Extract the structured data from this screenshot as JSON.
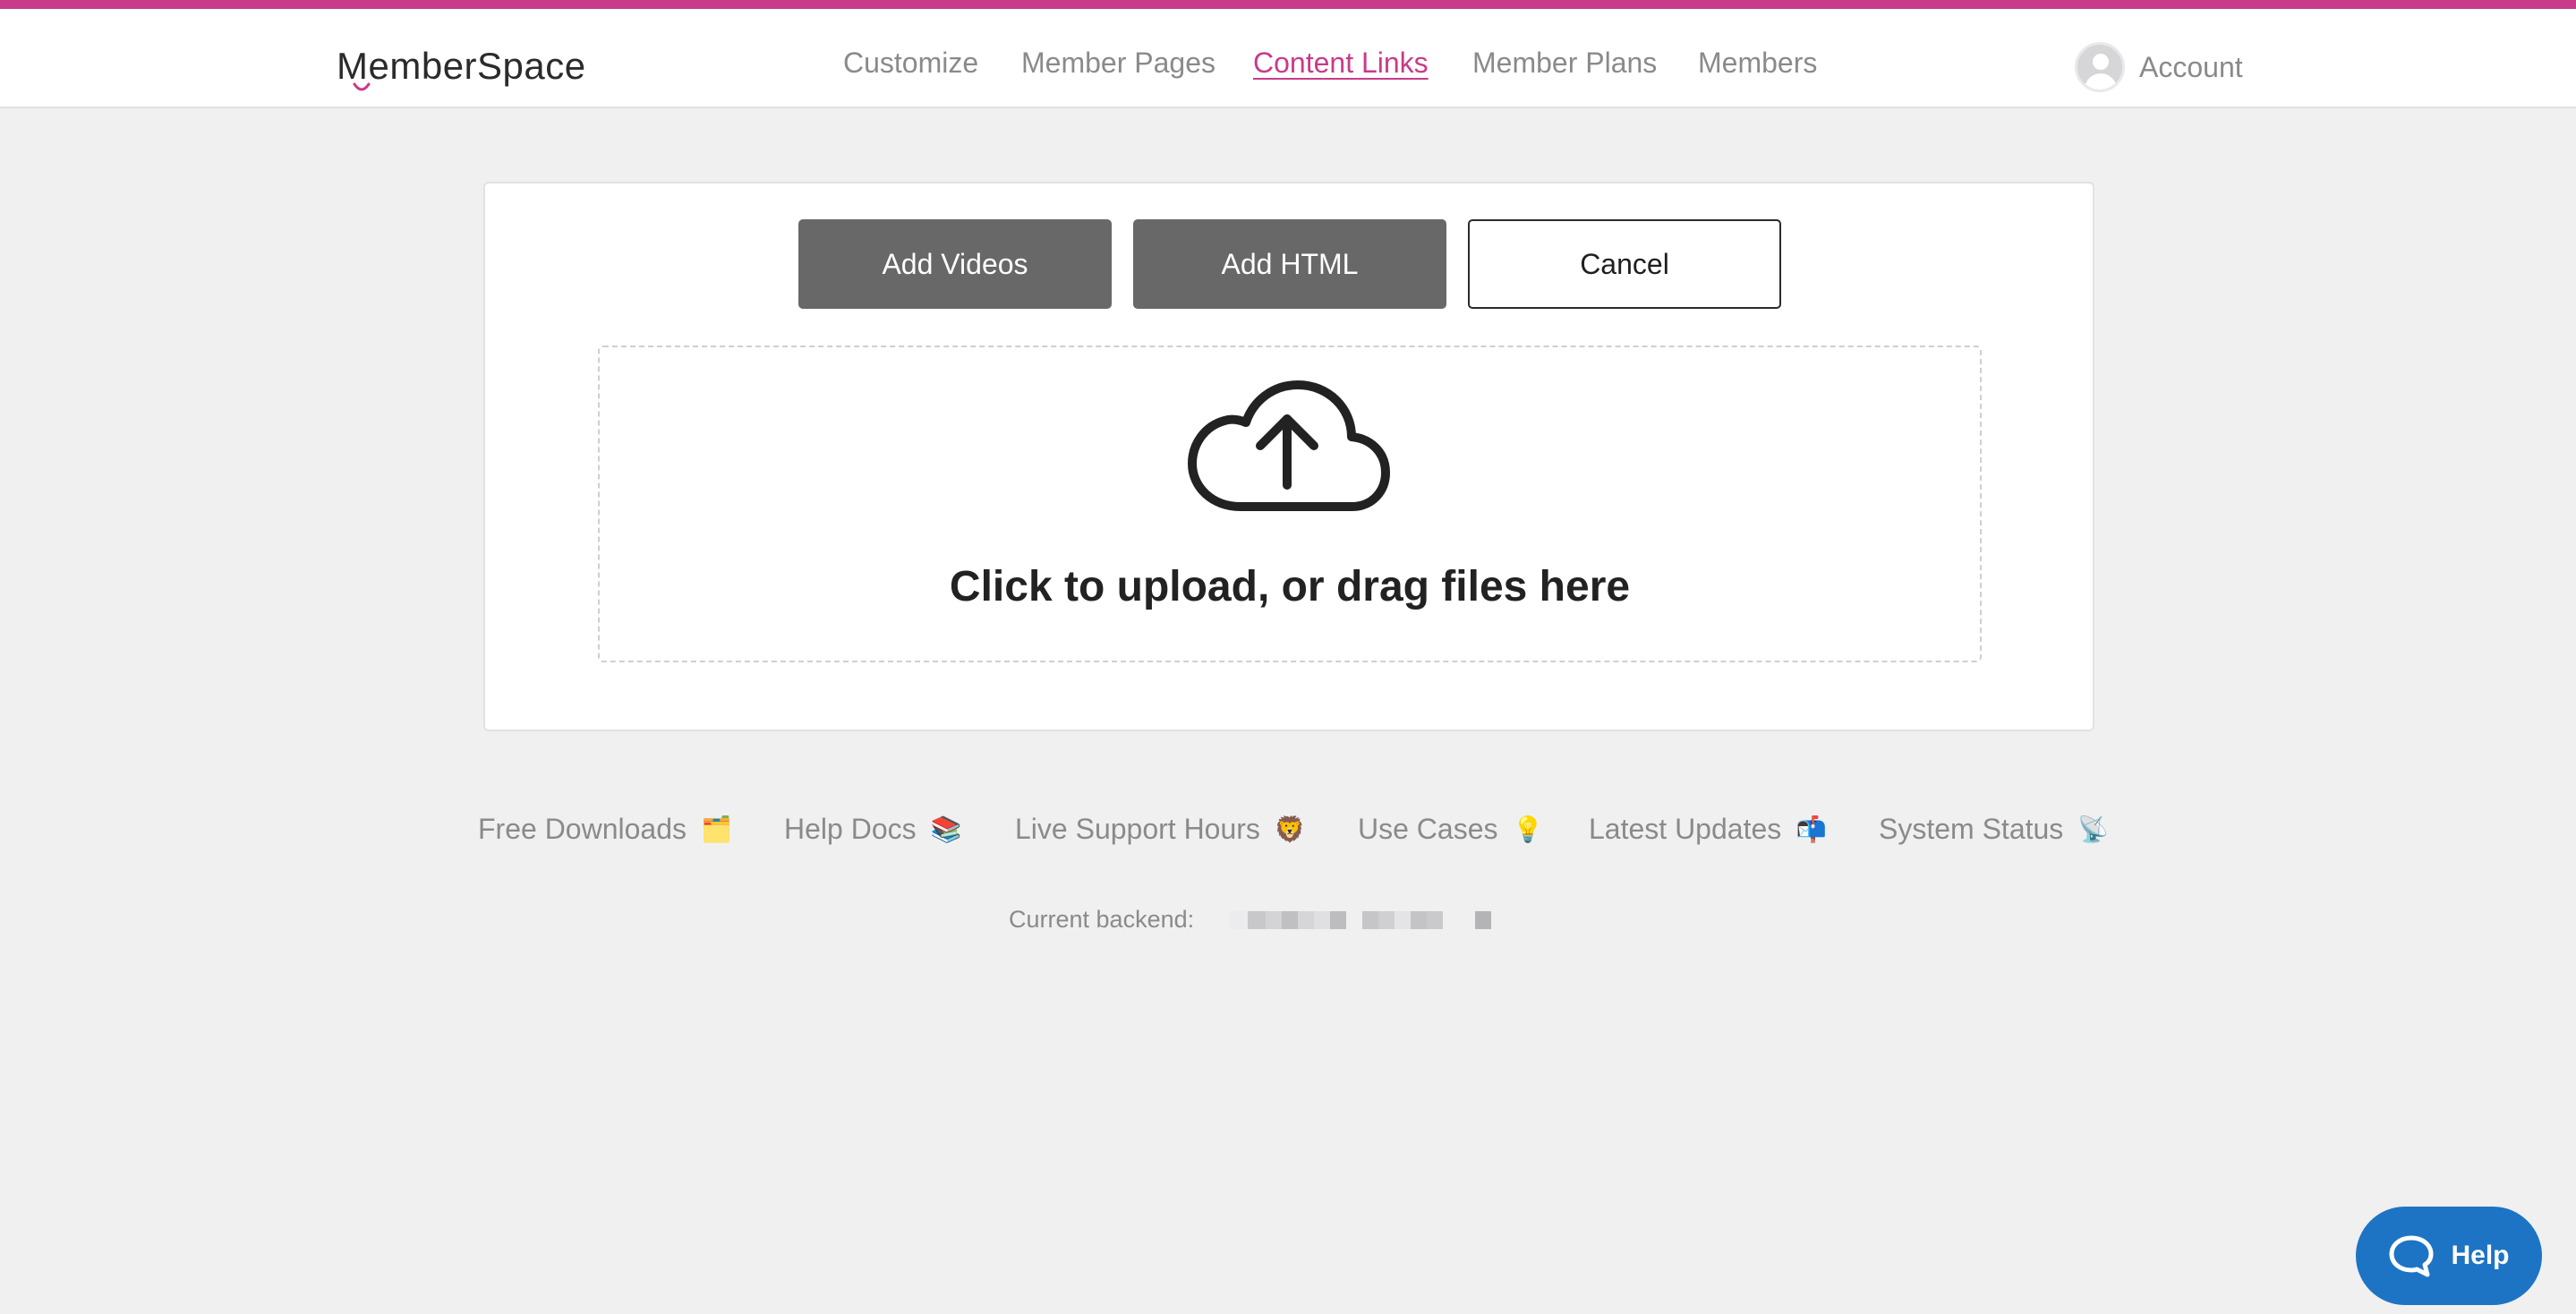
{
  "colors": {
    "accent": "#c93b8a",
    "button_dark": "#686868",
    "help_blue": "#1d74c4",
    "background": "#f0f0f1"
  },
  "header": {
    "logo_text": "emberSpace",
    "logo_initial": "M",
    "nav": [
      {
        "label": "Customize",
        "active": false
      },
      {
        "label": "Member Pages",
        "active": false
      },
      {
        "label": "Content Links",
        "active": true
      },
      {
        "label": "Member Plans",
        "active": false
      },
      {
        "label": "Members",
        "active": false
      }
    ],
    "account_label": "Account",
    "account_icon": "user-avatar-icon"
  },
  "uploader": {
    "add_videos_label": "Add Videos",
    "add_html_label": "Add HTML",
    "cancel_label": "Cancel",
    "dropzone_icon": "cloud-upload-icon",
    "dropzone_text": "Click to upload, or drag files here"
  },
  "footer": {
    "links": [
      {
        "label": "Free Downloads",
        "emoji": "🗂️"
      },
      {
        "label": "Help Docs",
        "emoji": "📚"
      },
      {
        "label": "Live Support Hours",
        "emoji": "🦁"
      },
      {
        "label": "Use Cases",
        "emoji": "💡"
      },
      {
        "label": "Latest Updates",
        "emoji": "📬"
      },
      {
        "label": "System Status",
        "emoji": "📡"
      }
    ],
    "backend_label": "Current backend:"
  },
  "help_widget": {
    "label": "Help",
    "icon": "chat-bubble-icon"
  }
}
